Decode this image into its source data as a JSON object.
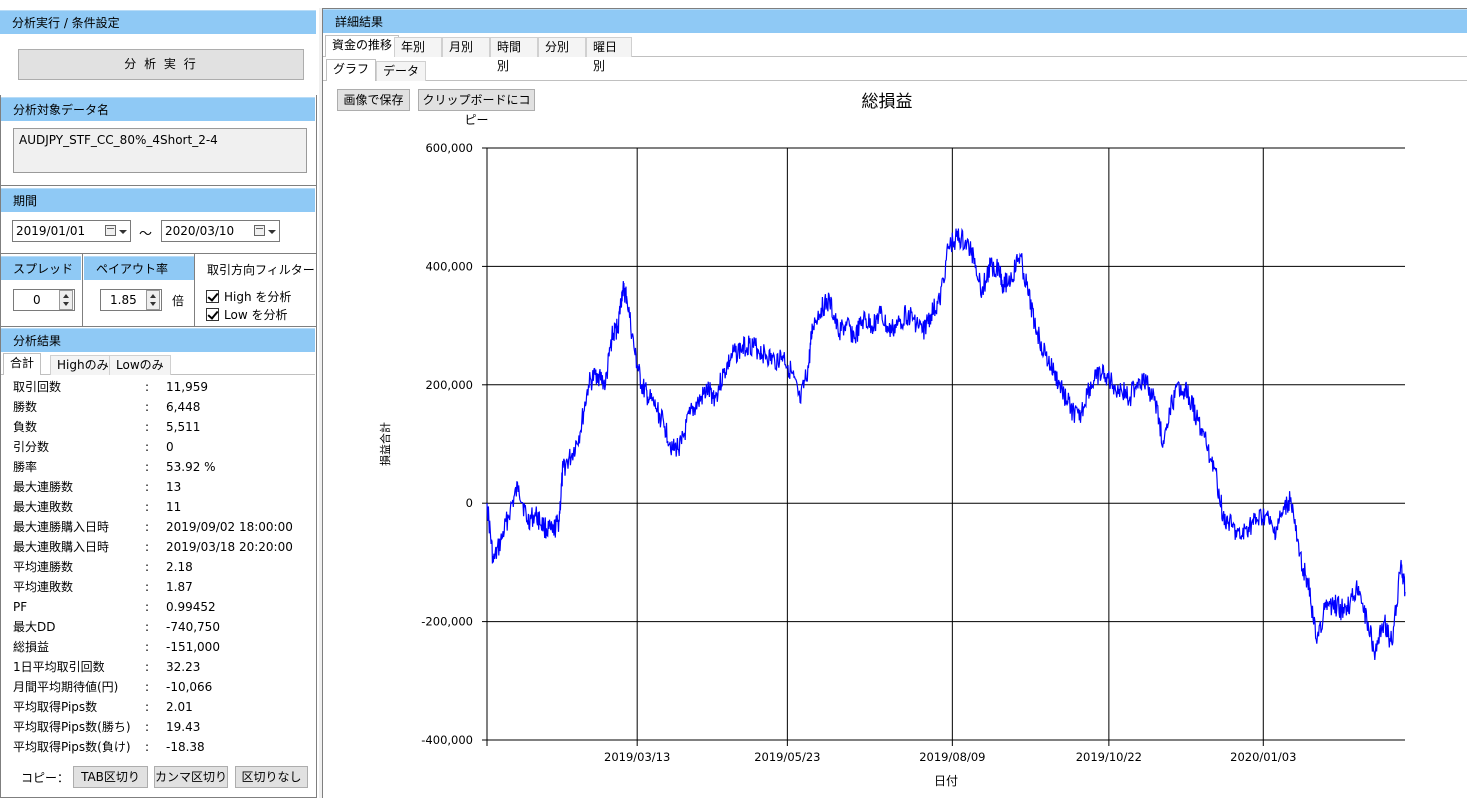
{
  "left": {
    "header": "分析実行 / 条件設定",
    "run_button": "分 析 実 行",
    "target": {
      "header": "分析対象データ名",
      "value": "AUDJPY_STF_CC_80%_4Short_2-4"
    },
    "period": {
      "header": "期間",
      "from": "2019/01/01",
      "tilde": "～",
      "to": "2020/03/10"
    },
    "spread": {
      "header": "スプレッド",
      "value": "0"
    },
    "payout": {
      "header": "ペイアウト率",
      "value": "1.85",
      "unit": "倍"
    },
    "direction": {
      "header": "取引方向フィルター",
      "high": "High を分析",
      "low": "Low を分析",
      "high_checked": true,
      "low_checked": true
    },
    "results": {
      "header": "分析結果",
      "tabs": [
        "合計",
        "Highのみ",
        "Lowのみ"
      ],
      "colon": ":",
      "stats": [
        {
          "label": "取引回数",
          "value": "11,959"
        },
        {
          "label": "勝数",
          "value": "6,448"
        },
        {
          "label": "負数",
          "value": "5,511"
        },
        {
          "label": "引分数",
          "value": "0"
        },
        {
          "label": "勝率",
          "value": "53.92 %"
        },
        {
          "label": "最大連勝数",
          "value": "13"
        },
        {
          "label": "最大連敗数",
          "value": "11"
        },
        {
          "label": "最大連勝購入日時",
          "value": "2019/09/02 18:00:00"
        },
        {
          "label": "最大連敗購入日時",
          "value": "2019/03/18 20:20:00"
        },
        {
          "label": "平均連勝数",
          "value": "2.18"
        },
        {
          "label": "平均連敗数",
          "value": "1.87"
        },
        {
          "label": "PF",
          "value": "0.99452"
        },
        {
          "label": "最大DD",
          "value": "-740,750"
        },
        {
          "label": "総損益",
          "value": "-151,000"
        },
        {
          "label": "1日平均取引回数",
          "value": "32.23"
        },
        {
          "label": "月間平均期待値(円)",
          "value": "-10,066"
        },
        {
          "label": "平均取得Pips数",
          "value": "2.01"
        },
        {
          "label": "平均取得Pips数(勝ち)",
          "value": "19.43"
        },
        {
          "label": "平均取得Pips数(負け)",
          "value": "-18.38"
        }
      ],
      "copy_label": "コピー：",
      "copy_buttons": [
        "TAB区切り",
        "カンマ区切り",
        "区切りなし"
      ]
    }
  },
  "right": {
    "header": "詳細結果",
    "tabs": [
      "資金の推移",
      "年別",
      "月別",
      "時間別",
      "分別",
      "曜日別"
    ],
    "subtabs": [
      "グラフ",
      "データ"
    ],
    "buttons": [
      "画像で保存",
      "クリップボードにコピー"
    ]
  },
  "chart_data": {
    "type": "line",
    "title": "総損益",
    "xlabel": "日付",
    "ylabel": "損益合計",
    "ylim": [
      -400000,
      600000
    ],
    "yticks": [
      -400000,
      -200000,
      0,
      200000,
      400000,
      600000
    ],
    "ytick_labels": [
      "-400,000",
      "-200,000",
      "0",
      "200,000",
      "400,000",
      "600,000"
    ],
    "xlim": [
      "2019-01-01",
      "2020-03-10"
    ],
    "xticks": [
      "2019-03-13",
      "2019-05-23",
      "2019-08-09",
      "2019-10-22",
      "2020-01-03"
    ],
    "xtick_labels": [
      "2019/03/13",
      "2019/05/23",
      "2019/08/09",
      "2019/10/22",
      "2020/01/03"
    ],
    "grid": true,
    "line_color": "#0000ff",
    "series": [
      {
        "x": [
          "2019-01-01",
          "2019-01-04",
          "2019-01-08",
          "2019-01-12",
          "2019-01-16",
          "2019-01-20",
          "2019-01-24",
          "2019-01-28",
          "2019-02-01",
          "2019-02-04",
          "2019-02-06",
          "2019-02-10",
          "2019-02-14",
          "2019-02-18",
          "2019-02-22",
          "2019-02-26",
          "2019-03-01",
          "2019-03-04",
          "2019-03-06",
          "2019-03-08",
          "2019-03-12",
          "2019-03-15",
          "2019-03-18",
          "2019-03-22",
          "2019-03-26",
          "2019-03-30",
          "2019-04-03",
          "2019-04-07",
          "2019-04-11",
          "2019-04-15",
          "2019-04-19",
          "2019-04-23",
          "2019-04-27",
          "2019-05-01",
          "2019-05-05",
          "2019-05-09",
          "2019-05-13",
          "2019-05-17",
          "2019-05-21",
          "2019-05-25",
          "2019-05-29",
          "2019-06-02",
          "2019-06-04",
          "2019-06-08",
          "2019-06-12",
          "2019-06-16",
          "2019-06-20",
          "2019-06-24",
          "2019-06-28",
          "2019-07-02",
          "2019-07-06",
          "2019-07-10",
          "2019-07-14",
          "2019-07-18",
          "2019-07-22",
          "2019-07-26",
          "2019-07-30",
          "2019-08-03",
          "2019-08-07",
          "2019-08-11",
          "2019-08-15",
          "2019-08-19",
          "2019-08-23",
          "2019-08-27",
          "2019-08-31",
          "2019-09-02",
          "2019-09-06",
          "2019-09-10",
          "2019-09-14",
          "2019-09-18",
          "2019-09-22",
          "2019-09-26",
          "2019-09-30",
          "2019-10-04",
          "2019-10-08",
          "2019-10-12",
          "2019-10-16",
          "2019-10-20",
          "2019-10-24",
          "2019-10-28",
          "2019-11-01",
          "2019-11-05",
          "2019-11-09",
          "2019-11-13",
          "2019-11-17",
          "2019-11-21",
          "2019-11-25",
          "2019-11-29",
          "2019-12-03",
          "2019-12-07",
          "2019-12-11",
          "2019-12-15",
          "2019-12-19",
          "2019-12-23",
          "2019-12-27",
          "2019-12-31",
          "2020-01-04",
          "2020-01-08",
          "2020-01-12",
          "2020-01-16",
          "2020-01-20",
          "2020-01-24",
          "2020-01-28",
          "2020-02-01",
          "2020-02-05",
          "2020-02-09",
          "2020-02-13",
          "2020-02-17",
          "2020-02-21",
          "2020-02-25",
          "2020-02-29",
          "2020-03-04",
          "2020-03-08",
          "2020-03-10"
        ],
        "y": [
          0,
          -100000,
          -60000,
          -10000,
          30000,
          -30000,
          -20000,
          -40000,
          -50000,
          -30000,
          60000,
          80000,
          120000,
          200000,
          220000,
          200000,
          280000,
          300000,
          360000,
          350000,
          250000,
          200000,
          180000,
          160000,
          130000,
          90000,
          100000,
          150000,
          170000,
          190000,
          180000,
          220000,
          250000,
          260000,
          270000,
          260000,
          250000,
          240000,
          250000,
          220000,
          170000,
          230000,
          300000,
          330000,
          340000,
          290000,
          300000,
          280000,
          310000,
          300000,
          320000,
          290000,
          300000,
          320000,
          310000,
          290000,
          320000,
          340000,
          430000,
          450000,
          440000,
          420000,
          360000,
          400000,
          400000,
          370000,
          380000,
          420000,
          350000,
          290000,
          250000,
          220000,
          190000,
          160000,
          140000,
          190000,
          210000,
          220000,
          200000,
          190000,
          180000,
          210000,
          200000,
          170000,
          100000,
          170000,
          200000,
          180000,
          140000,
          100000,
          60000,
          -20000,
          -40000,
          -60000,
          -40000,
          -30000,
          -20000,
          -50000,
          -20000,
          10000,
          -90000,
          -130000,
          -230000,
          -180000,
          -170000,
          -180000,
          -170000,
          -140000,
          -200000,
          -250000,
          -200000,
          -240000,
          -100000,
          -150000
        ]
      }
    ]
  }
}
